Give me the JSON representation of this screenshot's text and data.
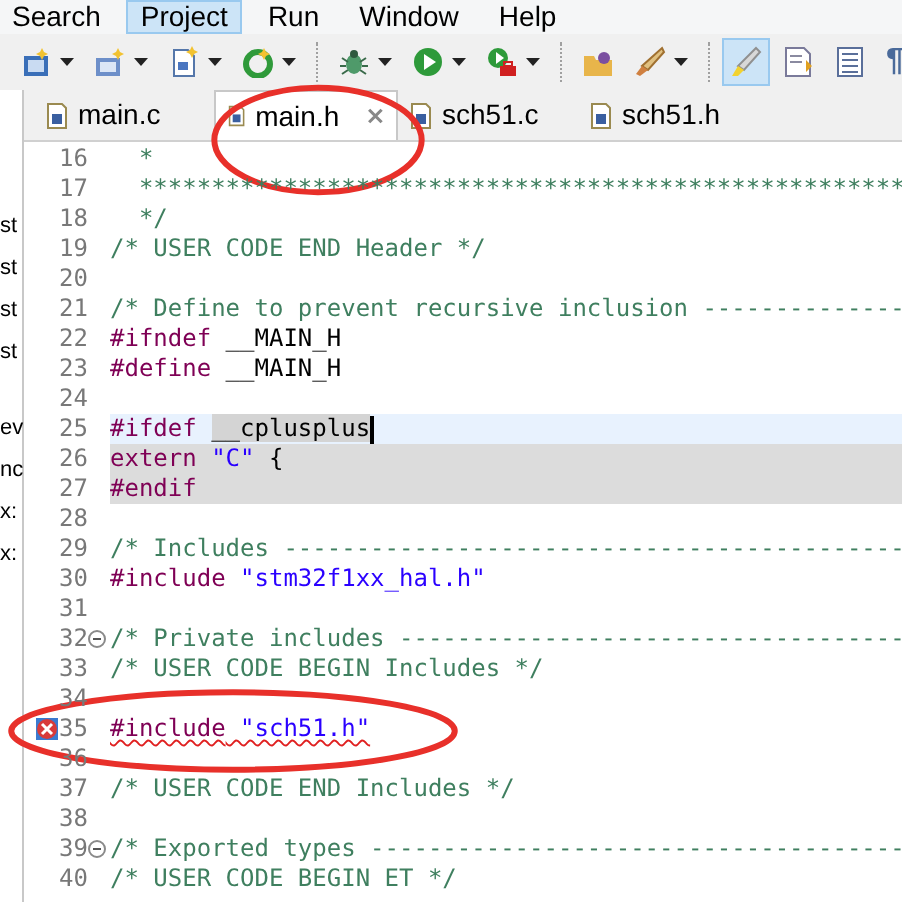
{
  "menu": [
    {
      "label": "Search",
      "selected": false
    },
    {
      "label": "Project",
      "selected": true
    },
    {
      "label": "Run",
      "selected": false
    },
    {
      "label": "Window",
      "selected": false
    },
    {
      "label": "Help",
      "selected": false
    }
  ],
  "toolbar": [
    {
      "kind": "c-project",
      "dropdown": true,
      "selected": false
    },
    {
      "kind": "c-class",
      "dropdown": true,
      "selected": false
    },
    {
      "kind": "c-file",
      "dropdown": true,
      "selected": false
    },
    {
      "kind": "refresh",
      "dropdown": true,
      "selected": false
    },
    {
      "kind": "separator"
    },
    {
      "kind": "bug",
      "dropdown": true,
      "selected": false
    },
    {
      "kind": "run",
      "dropdown": true,
      "selected": false
    },
    {
      "kind": "run-tool",
      "dropdown": true,
      "selected": false
    },
    {
      "kind": "separator"
    },
    {
      "kind": "folder",
      "dropdown": false,
      "selected": false
    },
    {
      "kind": "brush",
      "dropdown": true,
      "selected": false
    },
    {
      "kind": "separator"
    },
    {
      "kind": "highlighter",
      "dropdown": false,
      "selected": true
    },
    {
      "kind": "doc-arrow",
      "dropdown": false,
      "selected": false
    },
    {
      "kind": "doc-lines",
      "dropdown": false,
      "selected": false
    },
    {
      "kind": "text",
      "text": "¶",
      "dropdown": false,
      "selected": false
    }
  ],
  "left_panel": {
    "groups": [
      [
        "st",
        "st",
        "st",
        "st"
      ],
      [
        "ev",
        "nc",
        "x:",
        "x:"
      ]
    ]
  },
  "tabs": [
    {
      "label": "main.c",
      "selected": false,
      "closable": false,
      "circled": false
    },
    {
      "label": "main.h",
      "selected": true,
      "closable": true,
      "circled": true
    },
    {
      "label": "sch51.c",
      "selected": false,
      "closable": false,
      "circled": false
    },
    {
      "label": "sch51.h",
      "selected": false,
      "closable": false,
      "circled": false
    }
  ],
  "code_lines": [
    {
      "number": "16",
      "tokens": [
        {
          "kind": "comment",
          "text": "  *"
        }
      ]
    },
    {
      "number": "17",
      "tokens": [
        {
          "kind": "comment",
          "text": "  *****************************************************"
        }
      ]
    },
    {
      "number": "18",
      "tokens": [
        {
          "kind": "comment",
          "text": "  */"
        }
      ]
    },
    {
      "number": "19",
      "tokens": [
        {
          "kind": "comment",
          "text": "/* USER CODE END Header */"
        }
      ]
    },
    {
      "number": "20"
    },
    {
      "number": "21",
      "tokens": [
        {
          "kind": "comment",
          "text": "/* Define to prevent recursive inclusion --------------"
        }
      ]
    },
    {
      "number": "22",
      "tokens": [
        {
          "kind": "directive",
          "text": "#ifndef"
        },
        {
          "kind": "plain",
          "text": " __MAIN_H"
        }
      ]
    },
    {
      "number": "23",
      "tokens": [
        {
          "kind": "directive",
          "text": "#define"
        },
        {
          "kind": "plain",
          "text": " __MAIN_H"
        }
      ]
    },
    {
      "number": "24"
    },
    {
      "number": "25",
      "current": true,
      "caret": true,
      "tokens": [
        {
          "kind": "directive",
          "text": "#ifdef "
        },
        {
          "kind": "occurrence",
          "text": "__cplusplus"
        }
      ]
    },
    {
      "number": "26",
      "inactive": true,
      "tokens": [
        {
          "kind": "directive",
          "text": "extern"
        },
        {
          "kind": "string",
          "text": " \"C\""
        },
        {
          "kind": "plain",
          "text": " {"
        }
      ]
    },
    {
      "number": "27",
      "inactive": true,
      "tokens": [
        {
          "kind": "directive",
          "text": "#endif"
        }
      ]
    },
    {
      "number": "28"
    },
    {
      "number": "29",
      "tokens": [
        {
          "kind": "comment",
          "text": "/* Includes -------------------------------------------"
        }
      ]
    },
    {
      "number": "30",
      "tokens": [
        {
          "kind": "directive",
          "text": "#include"
        },
        {
          "kind": "string",
          "text": " \"stm32f1xx_hal.h\""
        }
      ]
    },
    {
      "number": "31"
    },
    {
      "number": "32",
      "fold": true,
      "tokens": [
        {
          "kind": "comment",
          "text": "/* Private includes -----------------------------------"
        }
      ]
    },
    {
      "number": "33",
      "tokens": [
        {
          "kind": "comment",
          "text": "/* USER CODE BEGIN Includes */"
        }
      ]
    },
    {
      "number": "34"
    },
    {
      "number": "35",
      "error": true,
      "circled": true,
      "tokens": [
        {
          "kind": "directive",
          "text": "#include"
        },
        {
          "kind": "string",
          "text": " \"sch51.h\""
        }
      ]
    },
    {
      "number": "36"
    },
    {
      "number": "37",
      "tokens": [
        {
          "kind": "comment",
          "text": "/* USER CODE END Includes */"
        }
      ]
    },
    {
      "number": "38"
    },
    {
      "number": "39",
      "fold": true,
      "tokens": [
        {
          "kind": "comment",
          "text": "/* Exported types -------------------------------------"
        }
      ]
    },
    {
      "number": "40",
      "tokens": [
        {
          "kind": "comment",
          "text": "/* USER CODE BEGIN ET */"
        }
      ]
    }
  ]
}
